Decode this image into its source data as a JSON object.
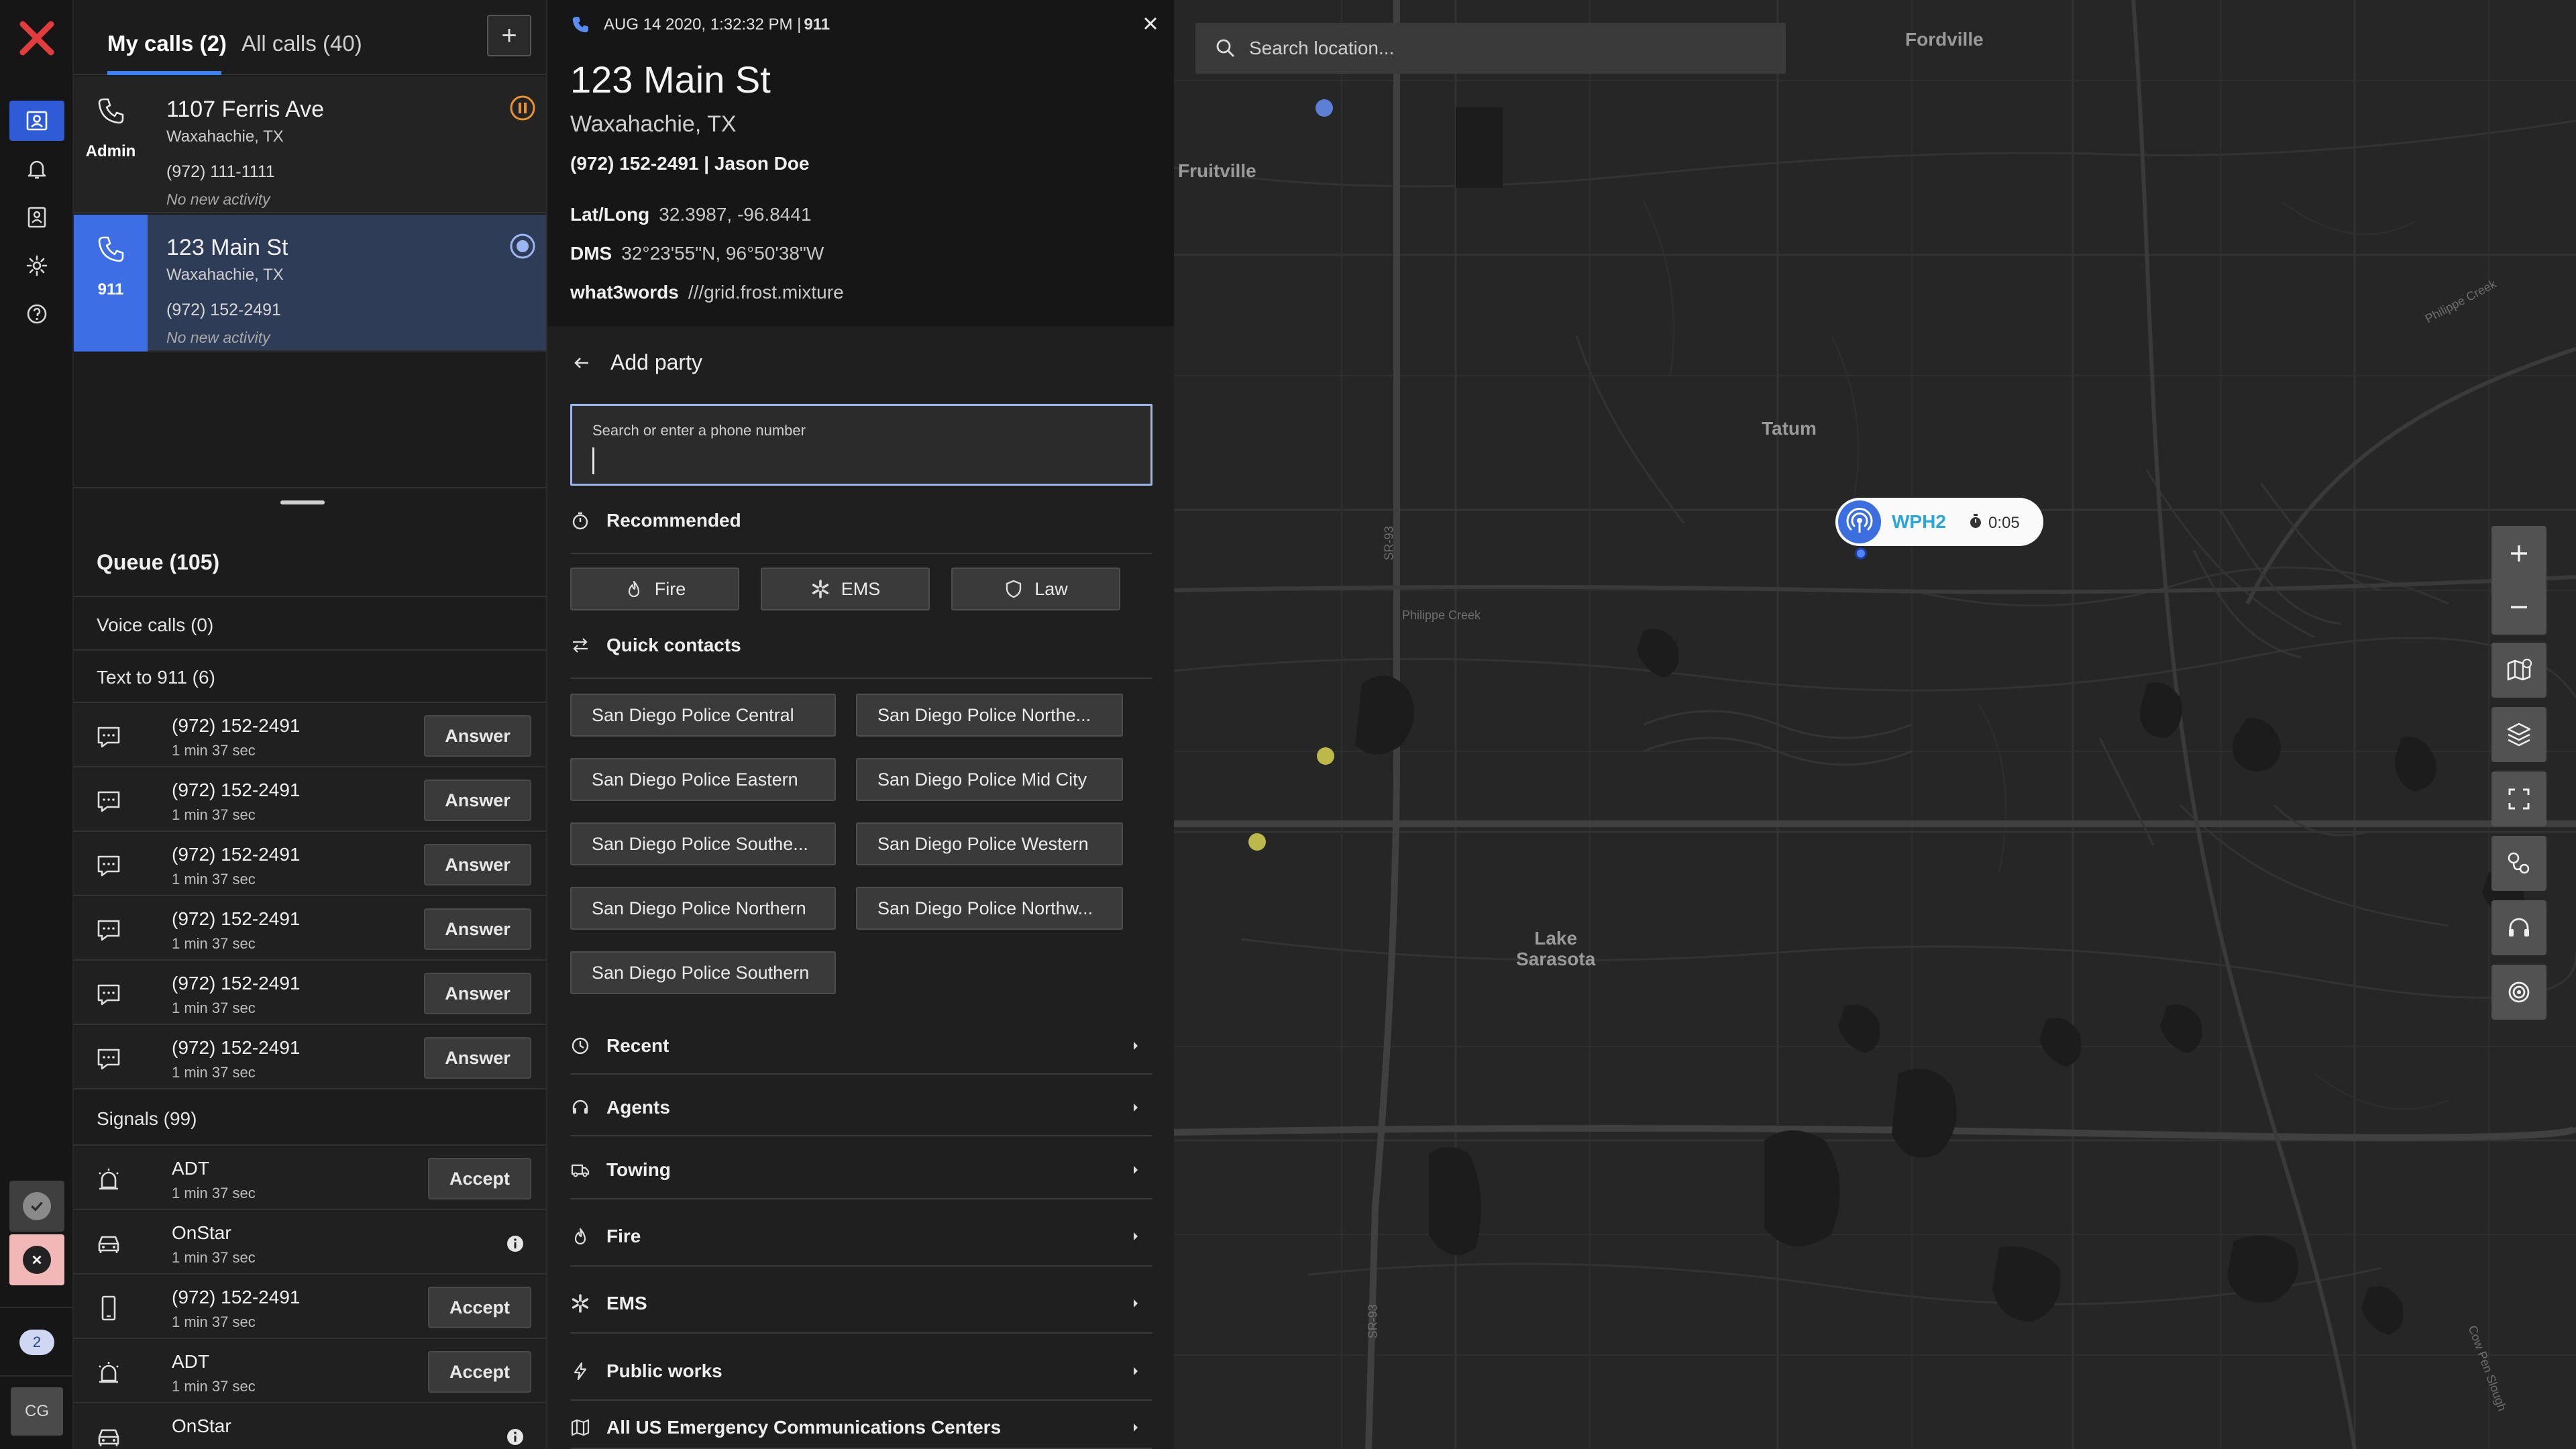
{
  "calls_panel": {
    "tabs": [
      {
        "label": "My calls (2)"
      },
      {
        "label": "All calls (40)"
      }
    ],
    "add_label": "+",
    "calls": [
      {
        "address": "1107 Ferris Ave",
        "city": "Waxahachie, TX",
        "phone": "(972) 111-1111",
        "activity": "No new activity",
        "role": "Admin",
        "status": "paused"
      },
      {
        "address": "123 Main St",
        "city": "Waxahachie, TX",
        "phone": "(972) 152-2491",
        "activity": "No new activity",
        "role": "911",
        "status": "active"
      }
    ]
  },
  "queue": {
    "title": "Queue (105)",
    "voice_calls": "Voice calls (0)",
    "text_to_911": "Text to 911   (6)",
    "text_rows": [
      {
        "phone": "(972) 152-2491",
        "duration": "1 min 37 sec",
        "action": "Answer"
      },
      {
        "phone": "(972) 152-2491",
        "duration": "1 min 37 sec",
        "action": "Answer"
      },
      {
        "phone": "(972) 152-2491",
        "duration": "1 min 37 sec",
        "action": "Answer"
      },
      {
        "phone": "(972) 152-2491",
        "duration": "1 min 37 sec",
        "action": "Answer"
      },
      {
        "phone": "(972) 152-2491",
        "duration": "1 min 37 sec",
        "action": "Answer"
      },
      {
        "phone": "(972) 152-2491",
        "duration": "1 min 37 sec",
        "action": "Answer"
      }
    ],
    "signals_title": "Signals (99)",
    "signal_rows": [
      {
        "name": "ADT",
        "duration": "1 min 37 sec",
        "action": "Accept",
        "icon": "alarm-icon"
      },
      {
        "name": "OnStar",
        "duration": "1 min 37 sec",
        "action": "",
        "icon": "car-icon"
      },
      {
        "name": "(972) 152-2491",
        "duration": "1 min 37 sec",
        "action": "Accept",
        "icon": "mobile-icon"
      },
      {
        "name": "ADT",
        "duration": "1 min 37 sec",
        "action": "Accept",
        "icon": "alarm-icon"
      },
      {
        "name": "OnStar",
        "duration": "",
        "action": "",
        "icon": "car-icon"
      }
    ]
  },
  "rail": {
    "badge": "2",
    "avatar": "CG"
  },
  "detail": {
    "datetime": "AUG 14 2020, 1:32:32 PM  |",
    "call_type": "911",
    "address": "123 Main St",
    "city": "Waxahachie, TX",
    "contact": "(972) 152-2491  |  Jason Doe",
    "latlong_label": "Lat/Long",
    "latlong_value": "32.3987, -96.8441",
    "dms_label": "DMS",
    "dms_value": "32°23'55\"N, 96°50'38\"W",
    "w3w_label": "what3words",
    "w3w_value": "///grid.frost.mixture"
  },
  "add_party": {
    "title": "Add party",
    "input_label": "Search or enter a phone number",
    "recommended_title": "Recommended",
    "recommended": [
      {
        "label": "Fire"
      },
      {
        "label": "EMS"
      },
      {
        "label": "Law"
      }
    ],
    "quick_title": "Quick contacts",
    "quick_contacts": [
      "San Diego Police Central",
      "San Diego Police Northe...",
      "San Diego Police Eastern",
      "San Diego Police Mid City",
      "San Diego Police Southe...",
      "San Diego Police Western",
      "San Diego Police Northern",
      "San Diego Police Northw...",
      "San Diego Police Southern"
    ],
    "categories": [
      {
        "label": "Recent",
        "icon": "clock-icon"
      },
      {
        "label": "Agents",
        "icon": "headset-icon"
      },
      {
        "label": "Towing",
        "icon": "truck-icon"
      },
      {
        "label": "Fire",
        "icon": "flame-icon"
      },
      {
        "label": "EMS",
        "icon": "ems-icon"
      },
      {
        "label": "Public works",
        "icon": "bolt-icon"
      },
      {
        "label": "All US Emergency Communications Centers",
        "icon": "map-icon"
      }
    ]
  },
  "map": {
    "search_placeholder": "Search location...",
    "labels": {
      "fordville": "Fordville",
      "fruitville": "Fruitville",
      "tatum": "Tatum",
      "lake_sarasota": "Lake\nSarasota",
      "sr93_a": "SR-93",
      "sr93_b": "SR-93",
      "philippe_creek_a": "Philippe Creek",
      "philippe_creek_b": "Philippe Creek",
      "cow_pen_slough": "Cow Pen Slough"
    },
    "pin": {
      "label": "WPH2",
      "time": "0:05"
    },
    "colors": {
      "pin_label": "#29a7d9",
      "marker_yellow": "#bdb84a",
      "marker_blue": "#5d7fd6"
    }
  }
}
